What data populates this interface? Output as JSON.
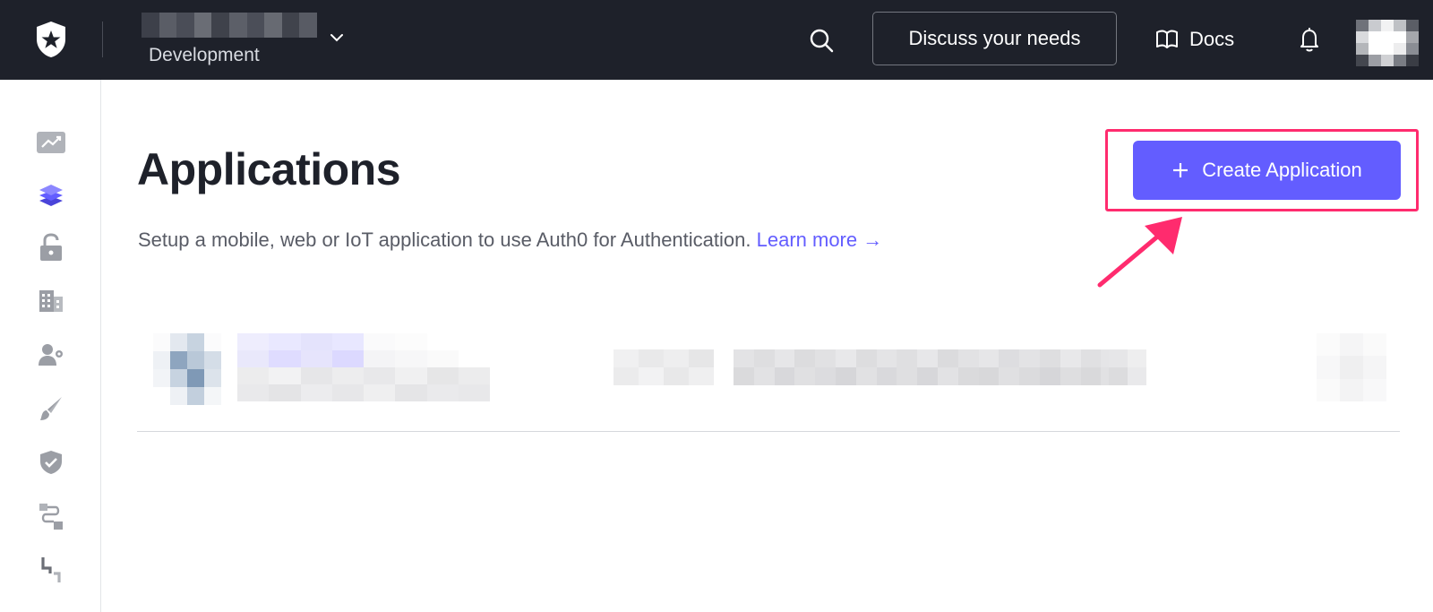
{
  "topbar": {
    "tenant_environment": "Development",
    "discuss_label": "Discuss your needs",
    "docs_label": "Docs"
  },
  "sidebar": {
    "items": [
      {
        "icon": "activity-chart-icon"
      },
      {
        "icon": "applications-layers-icon"
      },
      {
        "icon": "authentication-lock-icon"
      },
      {
        "icon": "organizations-building-icon"
      },
      {
        "icon": "user-management-icon"
      },
      {
        "icon": "branding-brush-icon"
      },
      {
        "icon": "security-shield-icon"
      },
      {
        "icon": "actions-flow-icon"
      },
      {
        "icon": "auth-pipeline-icon"
      }
    ]
  },
  "main": {
    "title": "Applications",
    "description": "Setup a mobile, web or IoT application to use Auth0 for Authentication.",
    "learn_more": "Learn more →",
    "create_button_label": "Create Application"
  },
  "colors": {
    "topbar_bg": "#1e212a",
    "accent": "#635dff",
    "highlight": "#ff2b6e"
  }
}
